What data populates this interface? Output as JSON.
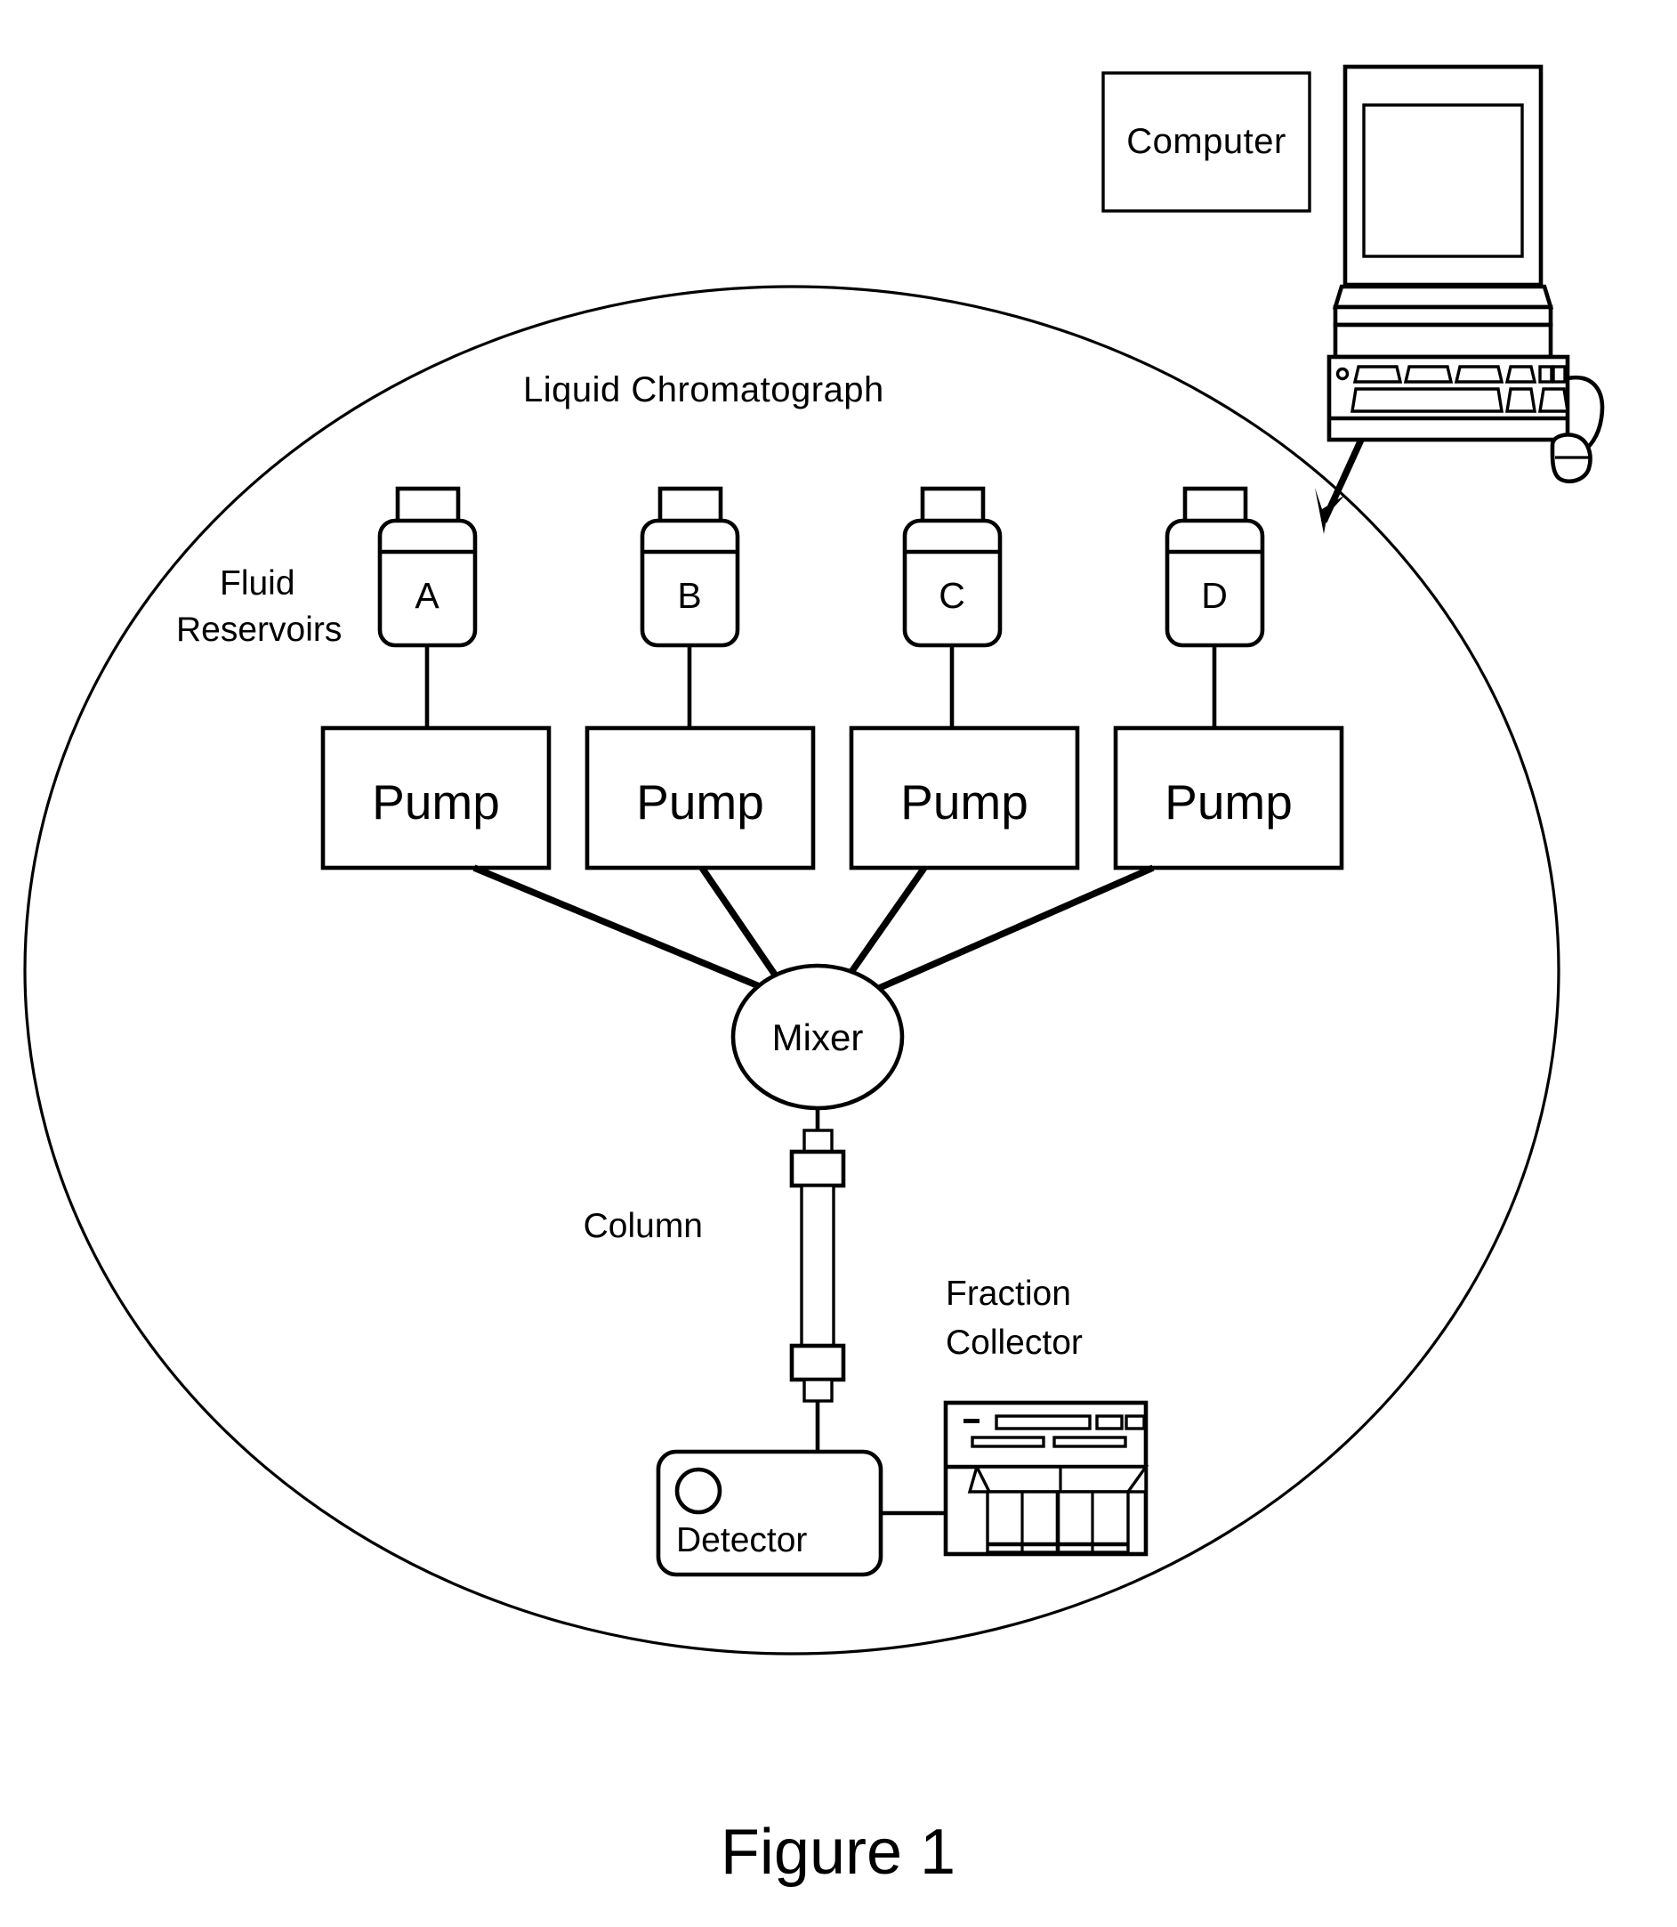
{
  "figure": {
    "caption": "Figure 1",
    "system_label": "Liquid Chromatograph",
    "computer_label": "Computer",
    "reservoirs_label_line1": "Fluid",
    "reservoirs_label_line2": "Reservoirs",
    "mixer_label": "Mixer",
    "column_label": "Column",
    "detector_label": "Detector",
    "fraction_collector_line1": "Fraction",
    "fraction_collector_line2": "Collector"
  },
  "reservoirs": [
    {
      "id": "A",
      "label": "A"
    },
    {
      "id": "B",
      "label": "B"
    },
    {
      "id": "C",
      "label": "C"
    },
    {
      "id": "D",
      "label": "D"
    }
  ],
  "pumps": [
    {
      "id": "pump-a",
      "label": "Pump"
    },
    {
      "id": "pump-b",
      "label": "Pump"
    },
    {
      "id": "pump-c",
      "label": "Pump"
    },
    {
      "id": "pump-d",
      "label": "Pump"
    }
  ],
  "icons": {
    "computer": "computer-workstation-icon",
    "monitor": "monitor-icon",
    "keyboard": "keyboard-icon",
    "mouse": "mouse-icon",
    "bottle": "reagent-bottle-icon",
    "collector_rack": "vial-rack-icon",
    "detector_cell": "detector-cell-icon",
    "arrow": "arrow-down-left-icon"
  },
  "colors": {
    "stroke": "#000000",
    "background": "#ffffff"
  }
}
